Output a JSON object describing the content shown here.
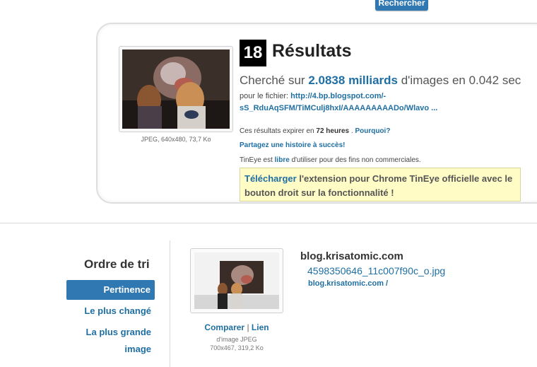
{
  "search": {
    "button_label": "Rechercher"
  },
  "query": {
    "image_meta": "JPEG, 640x480, 73,7 Ko"
  },
  "results": {
    "count": "18",
    "title": "Résultats",
    "searched_prefix": "Cherché sur",
    "searched_count": "2.0838 milliards",
    "searched_suffix": "d'images en 0.042 sec",
    "file_label": "pour le fichier:",
    "file_url_line1": "http://4.bp.blogspot.com/-",
    "file_url_line2": "sS_RduAqSFM/TiMCulj8hxI/AAAAAAAAADo/Wlavo ...",
    "expire_prefix": "Ces résultats expirer en",
    "expire_time": "72 heures",
    "expire_sep": ".",
    "why_link": "Pourquoi?",
    "share_link": "Partagez une histoire à succès!",
    "free_prefix": "TinEye est",
    "free_link": "libre",
    "free_suffix": "d'utiliser pour des fins non commerciales.",
    "promo_link": "Télécharger",
    "promo_text": "l'extension pour Chrome TinEye officielle avec le bouton droit sur la fonctionnalité !"
  },
  "sort": {
    "title": "Ordre de tri",
    "options": [
      "Pertinence",
      "Le plus changé",
      "La plus grande",
      "image"
    ]
  },
  "result_item": {
    "compare": "Comparer",
    "separator": "|",
    "link": "Lien",
    "meta_line1": "d'image JPEG",
    "meta_line2": "700x467, 319,2 Ko",
    "domain": "blog.krisatomic.com",
    "filename": "4598350646_11c007f90c_o.jpg",
    "page": "blog.krisatomic.com /"
  },
  "colors": {
    "accent": "#2f78b1",
    "link": "#1f6fa3",
    "promo_bg": "#fffcc6"
  }
}
